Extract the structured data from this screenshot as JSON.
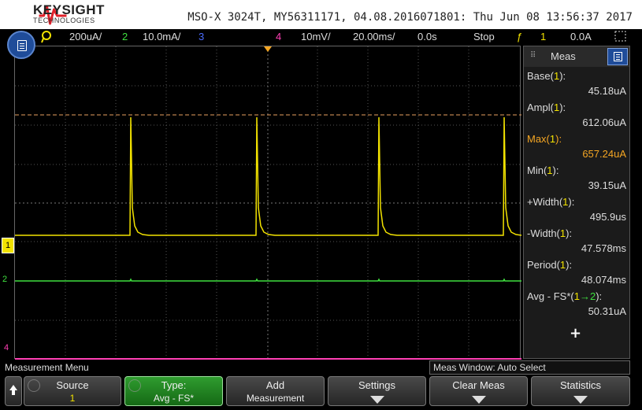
{
  "header": {
    "brand": "KEYSIGHT",
    "brand_sub": "TECHNOLOGIES",
    "model_line": "MSO-X 3024T, MY56311171, 04.08.2016071801: Thu Jun 08 13:56:37 2017"
  },
  "status": {
    "ch1_scale": "200uA/",
    "ch2_num": "2",
    "ch2_scale": "10.0mA/",
    "ch3_num": "3",
    "ch4_num": "4",
    "ch4_scale": "10mV/",
    "timebase": "20.00ms/",
    "delay": "0.0s",
    "run_state": "Stop",
    "trigger_source": "1",
    "trigger_level": "0.0A"
  },
  "markers": {
    "ch1": "1",
    "ch2": "2",
    "ch4": "4"
  },
  "measurements": {
    "title": "Meas",
    "items": [
      {
        "label": "Base(",
        "ch": "1",
        "suffix": "):",
        "value": "45.18uA",
        "highlight": false
      },
      {
        "label": "Ampl(",
        "ch": "1",
        "suffix": "):",
        "value": "612.06uA",
        "highlight": false
      },
      {
        "label": "Max(",
        "ch": "1",
        "suffix": "):",
        "value": "657.24uA",
        "highlight": true
      },
      {
        "label": "Min(",
        "ch": "1",
        "suffix": "):",
        "value": "39.15uA",
        "highlight": false
      },
      {
        "label": "+Width(",
        "ch": "1",
        "suffix": "):",
        "value": "495.9us",
        "highlight": false
      },
      {
        "label": "-Width(",
        "ch": "1",
        "suffix": "):",
        "value": "47.578ms",
        "highlight": false
      },
      {
        "label": "Period(",
        "ch": "1",
        "suffix": "):",
        "value": "48.074ms",
        "highlight": false
      },
      {
        "label": "Avg - FS*(",
        "ch": "1",
        "ch_b": "→2",
        "suffix": "):",
        "value": "50.31uA",
        "highlight": false
      }
    ],
    "add_symbol": "+"
  },
  "menu": {
    "title": "Measurement Menu",
    "meas_window": "Meas Window: Auto Select",
    "softkeys": [
      {
        "label": "Source",
        "value": "1"
      },
      {
        "label": "Type:",
        "value": "Avg - FS*"
      },
      {
        "label": "Add",
        "value": "Measurement"
      },
      {
        "label": "Settings",
        "value": ""
      },
      {
        "label": "Clear Meas",
        "value": ""
      },
      {
        "label": "Statistics",
        "value": ""
      }
    ]
  },
  "colors": {
    "ch1": "#f2e200",
    "ch2": "#3fe03f",
    "ch3": "#4a6cff",
    "ch4": "#ff3fb4",
    "trigger": "#f5a623",
    "accent": "#1f4c99"
  }
}
